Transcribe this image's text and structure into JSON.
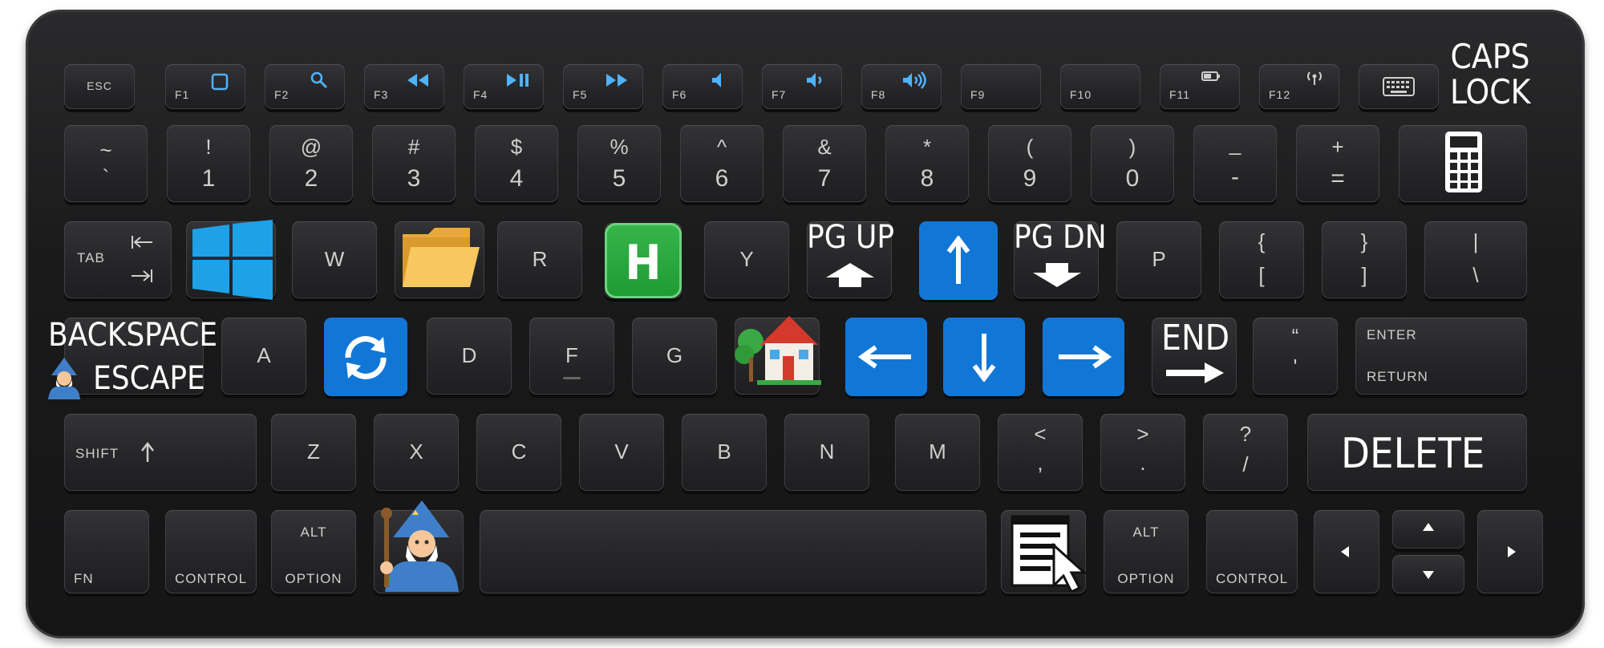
{
  "keyboard": {
    "fn_row": [
      {
        "id": "esc",
        "label": "ESC",
        "icon": ""
      },
      {
        "id": "f1",
        "label": "F1",
        "icon": "square-icon"
      },
      {
        "id": "f2",
        "label": "F2",
        "icon": "search-icon"
      },
      {
        "id": "f3",
        "label": "F3",
        "icon": "rewind-icon"
      },
      {
        "id": "f4",
        "label": "F4",
        "icon": "play-pause-icon"
      },
      {
        "id": "f5",
        "label": "F5",
        "icon": "fast-forward-icon"
      },
      {
        "id": "f6",
        "label": "F6",
        "icon": "volume-mute-icon"
      },
      {
        "id": "f7",
        "label": "F7",
        "icon": "volume-down-icon"
      },
      {
        "id": "f8",
        "label": "F8",
        "icon": "volume-up-icon"
      },
      {
        "id": "f9",
        "label": "F9",
        "icon": ""
      },
      {
        "id": "f10",
        "label": "F10",
        "icon": ""
      },
      {
        "id": "f11",
        "label": "F11",
        "icon": "battery-icon"
      },
      {
        "id": "f12",
        "label": "F12",
        "icon": "wireless-icon"
      },
      {
        "id": "kbd",
        "label": "",
        "icon": "keyboard-icon"
      }
    ],
    "number_row": [
      {
        "top": "~",
        "bottom": "`"
      },
      {
        "top": "!",
        "bottom": "1"
      },
      {
        "top": "@",
        "bottom": "2"
      },
      {
        "top": "#",
        "bottom": "3"
      },
      {
        "top": "$",
        "bottom": "4"
      },
      {
        "top": "%",
        "bottom": "5"
      },
      {
        "top": "^",
        "bottom": "6"
      },
      {
        "top": "&",
        "bottom": "7"
      },
      {
        "top": "*",
        "bottom": "8"
      },
      {
        "top": "(",
        "bottom": "9"
      },
      {
        "top": ")",
        "bottom": "0"
      },
      {
        "top": "_",
        "bottom": "-"
      },
      {
        "top": "+",
        "bottom": "="
      }
    ],
    "tab": "TAB",
    "top_letters": {
      "w": "W",
      "r": "R",
      "y": "Y",
      "p": "P"
    },
    "brackets": [
      {
        "top": "{",
        "bottom": "["
      },
      {
        "top": "}",
        "bottom": "]"
      },
      {
        "top": "|",
        "bottom": "\\"
      }
    ],
    "home_letters": {
      "a": "A",
      "d": "D",
      "f": "F",
      "g": "G"
    },
    "quote": {
      "top": "“",
      "bottom": "'"
    },
    "enter_top": "ENTER",
    "enter_bottom": "RETURN",
    "shift": "SHIFT",
    "bottom_letters": [
      "Z",
      "X",
      "C",
      "V",
      "B",
      "N",
      "M"
    ],
    "punct": [
      {
        "top": "<",
        "bottom": ","
      },
      {
        "top": ">",
        "bottom": "."
      },
      {
        "top": "?",
        "bottom": "/"
      }
    ],
    "fn": "FN",
    "control": "CONTROL",
    "alt": "ALT",
    "option": "OPTION"
  },
  "overlays": {
    "caps_lock": [
      "CAPS",
      "LOCK"
    ],
    "pg_up": "PG UP",
    "pg_dn": "PG DN",
    "end": "END",
    "backspace": "BACKSPACE",
    "escape": "ESCAPE",
    "delete": "DELETE",
    "h_letter": "H",
    "colors": {
      "blue": "#1177d7",
      "green": "#1f9a34",
      "folder": "#f6c85f"
    }
  }
}
